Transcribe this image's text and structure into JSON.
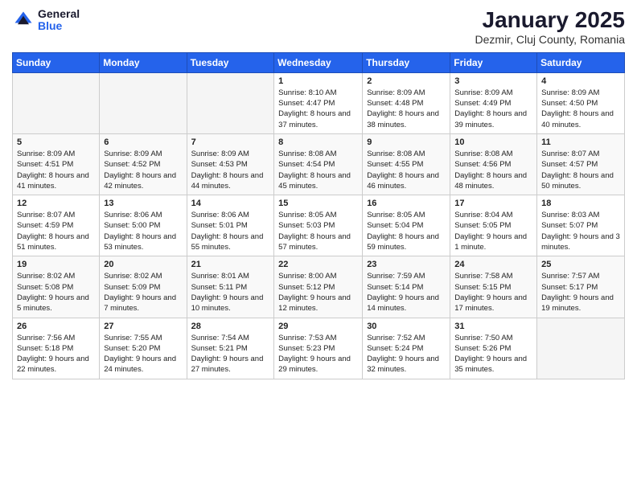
{
  "header": {
    "logo_general": "General",
    "logo_blue": "Blue",
    "month": "January 2025",
    "location": "Dezmir, Cluj County, Romania"
  },
  "weekdays": [
    "Sunday",
    "Monday",
    "Tuesday",
    "Wednesday",
    "Thursday",
    "Friday",
    "Saturday"
  ],
  "weeks": [
    [
      {
        "day": "",
        "info": ""
      },
      {
        "day": "",
        "info": ""
      },
      {
        "day": "",
        "info": ""
      },
      {
        "day": "1",
        "info": "Sunrise: 8:10 AM\nSunset: 4:47 PM\nDaylight: 8 hours and 37 minutes."
      },
      {
        "day": "2",
        "info": "Sunrise: 8:09 AM\nSunset: 4:48 PM\nDaylight: 8 hours and 38 minutes."
      },
      {
        "day": "3",
        "info": "Sunrise: 8:09 AM\nSunset: 4:49 PM\nDaylight: 8 hours and 39 minutes."
      },
      {
        "day": "4",
        "info": "Sunrise: 8:09 AM\nSunset: 4:50 PM\nDaylight: 8 hours and 40 minutes."
      }
    ],
    [
      {
        "day": "5",
        "info": "Sunrise: 8:09 AM\nSunset: 4:51 PM\nDaylight: 8 hours and 41 minutes."
      },
      {
        "day": "6",
        "info": "Sunrise: 8:09 AM\nSunset: 4:52 PM\nDaylight: 8 hours and 42 minutes."
      },
      {
        "day": "7",
        "info": "Sunrise: 8:09 AM\nSunset: 4:53 PM\nDaylight: 8 hours and 44 minutes."
      },
      {
        "day": "8",
        "info": "Sunrise: 8:08 AM\nSunset: 4:54 PM\nDaylight: 8 hours and 45 minutes."
      },
      {
        "day": "9",
        "info": "Sunrise: 8:08 AM\nSunset: 4:55 PM\nDaylight: 8 hours and 46 minutes."
      },
      {
        "day": "10",
        "info": "Sunrise: 8:08 AM\nSunset: 4:56 PM\nDaylight: 8 hours and 48 minutes."
      },
      {
        "day": "11",
        "info": "Sunrise: 8:07 AM\nSunset: 4:57 PM\nDaylight: 8 hours and 50 minutes."
      }
    ],
    [
      {
        "day": "12",
        "info": "Sunrise: 8:07 AM\nSunset: 4:59 PM\nDaylight: 8 hours and 51 minutes."
      },
      {
        "day": "13",
        "info": "Sunrise: 8:06 AM\nSunset: 5:00 PM\nDaylight: 8 hours and 53 minutes."
      },
      {
        "day": "14",
        "info": "Sunrise: 8:06 AM\nSunset: 5:01 PM\nDaylight: 8 hours and 55 minutes."
      },
      {
        "day": "15",
        "info": "Sunrise: 8:05 AM\nSunset: 5:03 PM\nDaylight: 8 hours and 57 minutes."
      },
      {
        "day": "16",
        "info": "Sunrise: 8:05 AM\nSunset: 5:04 PM\nDaylight: 8 hours and 59 minutes."
      },
      {
        "day": "17",
        "info": "Sunrise: 8:04 AM\nSunset: 5:05 PM\nDaylight: 9 hours and 1 minute."
      },
      {
        "day": "18",
        "info": "Sunrise: 8:03 AM\nSunset: 5:07 PM\nDaylight: 9 hours and 3 minutes."
      }
    ],
    [
      {
        "day": "19",
        "info": "Sunrise: 8:02 AM\nSunset: 5:08 PM\nDaylight: 9 hours and 5 minutes."
      },
      {
        "day": "20",
        "info": "Sunrise: 8:02 AM\nSunset: 5:09 PM\nDaylight: 9 hours and 7 minutes."
      },
      {
        "day": "21",
        "info": "Sunrise: 8:01 AM\nSunset: 5:11 PM\nDaylight: 9 hours and 10 minutes."
      },
      {
        "day": "22",
        "info": "Sunrise: 8:00 AM\nSunset: 5:12 PM\nDaylight: 9 hours and 12 minutes."
      },
      {
        "day": "23",
        "info": "Sunrise: 7:59 AM\nSunset: 5:14 PM\nDaylight: 9 hours and 14 minutes."
      },
      {
        "day": "24",
        "info": "Sunrise: 7:58 AM\nSunset: 5:15 PM\nDaylight: 9 hours and 17 minutes."
      },
      {
        "day": "25",
        "info": "Sunrise: 7:57 AM\nSunset: 5:17 PM\nDaylight: 9 hours and 19 minutes."
      }
    ],
    [
      {
        "day": "26",
        "info": "Sunrise: 7:56 AM\nSunset: 5:18 PM\nDaylight: 9 hours and 22 minutes."
      },
      {
        "day": "27",
        "info": "Sunrise: 7:55 AM\nSunset: 5:20 PM\nDaylight: 9 hours and 24 minutes."
      },
      {
        "day": "28",
        "info": "Sunrise: 7:54 AM\nSunset: 5:21 PM\nDaylight: 9 hours and 27 minutes."
      },
      {
        "day": "29",
        "info": "Sunrise: 7:53 AM\nSunset: 5:23 PM\nDaylight: 9 hours and 29 minutes."
      },
      {
        "day": "30",
        "info": "Sunrise: 7:52 AM\nSunset: 5:24 PM\nDaylight: 9 hours and 32 minutes."
      },
      {
        "day": "31",
        "info": "Sunrise: 7:50 AM\nSunset: 5:26 PM\nDaylight: 9 hours and 35 minutes."
      },
      {
        "day": "",
        "info": ""
      }
    ]
  ]
}
